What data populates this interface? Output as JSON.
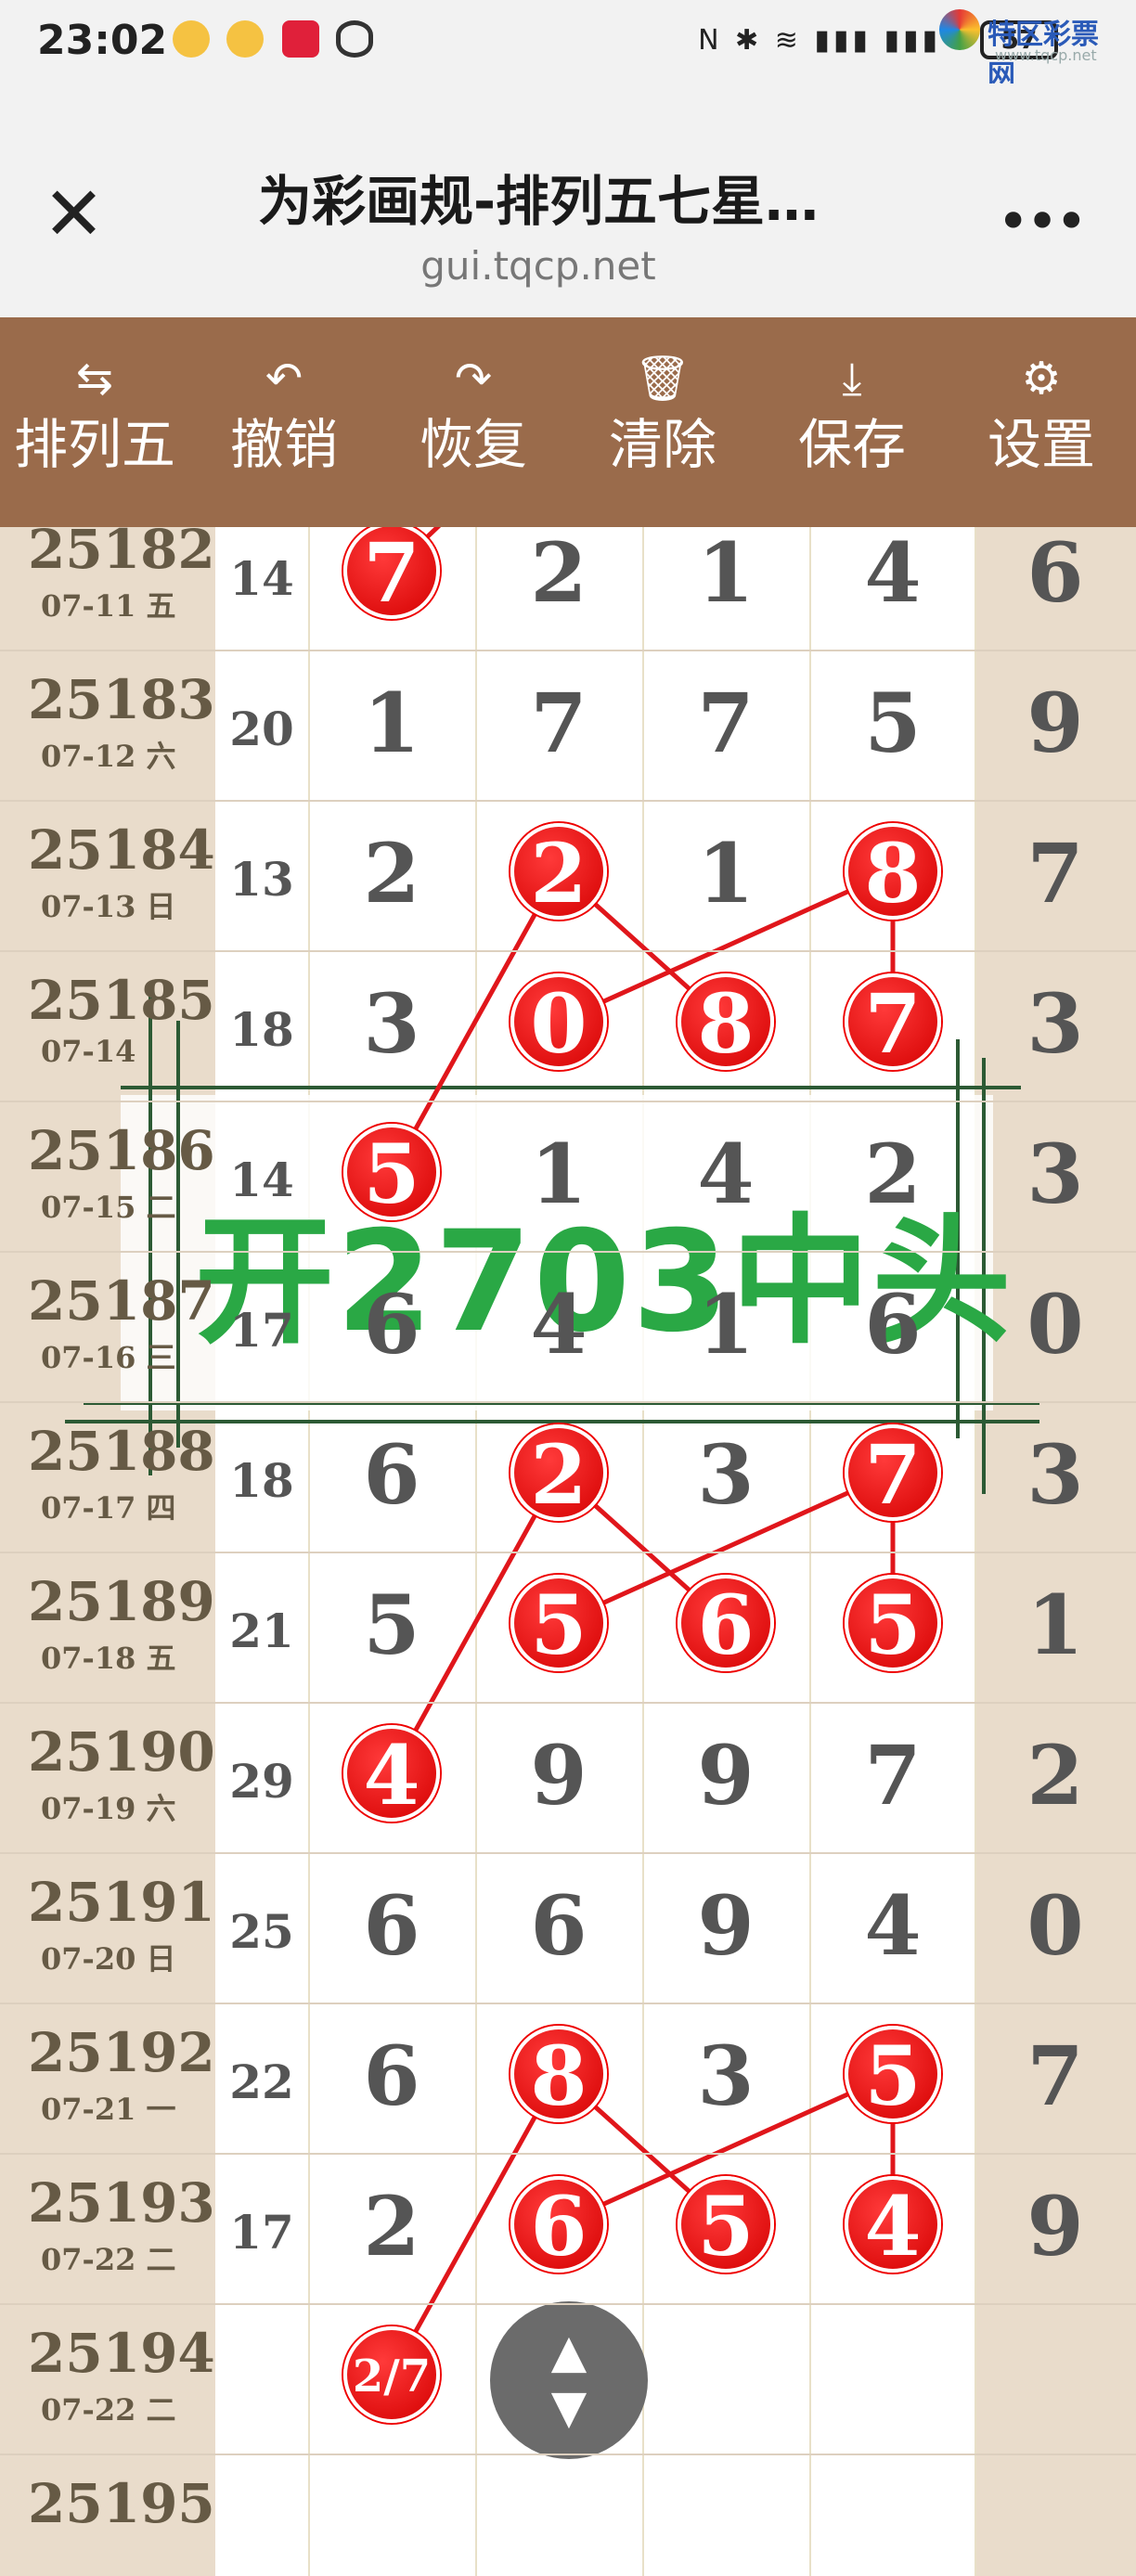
{
  "status": {
    "time": "23:02",
    "battery": "57",
    "brand": "特区彩票网",
    "brand_url": "www.tqcp.net"
  },
  "titlebar": {
    "title": "为彩画规-排列五七星…",
    "url": "gui.tqcp.net",
    "close": "✕",
    "more": "•••"
  },
  "toolbar": [
    {
      "icon": "⇆",
      "label": "排列五"
    },
    {
      "icon": "↶",
      "label": "撤销"
    },
    {
      "icon": "↷",
      "label": "恢复"
    },
    {
      "icon": "🗑",
      "label": "清除"
    },
    {
      "icon": "⤓",
      "label": "保存"
    },
    {
      "icon": "⚙",
      "label": "设置"
    }
  ],
  "overlay_text": "开2703中头",
  "rows": [
    {
      "issue": "25182",
      "date": "07-11 五",
      "sum": "14",
      "d": [
        "7",
        "2",
        "1",
        "4"
      ],
      "tail": "6",
      "hits": [
        0
      ]
    },
    {
      "issue": "25183",
      "date": "07-12 六",
      "sum": "20",
      "d": [
        "1",
        "7",
        "7",
        "5"
      ],
      "tail": "9",
      "hits": []
    },
    {
      "issue": "25184",
      "date": "07-13 日",
      "sum": "13",
      "d": [
        "2",
        "2",
        "1",
        "8"
      ],
      "tail": "7",
      "hits": [
        1,
        3
      ]
    },
    {
      "issue": "25185",
      "date": "07-14",
      "sum": "18",
      "d": [
        "3",
        "0",
        "8",
        "7"
      ],
      "tail": "3",
      "hits": [
        1,
        2,
        3
      ]
    },
    {
      "issue": "25186",
      "date": "07-15 二",
      "sum": "14",
      "d": [
        "5",
        "1",
        "4",
        "2"
      ],
      "tail": "3",
      "hits": [
        0
      ]
    },
    {
      "issue": "25187",
      "date": "07-16 三",
      "sum": "17",
      "d": [
        "6",
        "4",
        "1",
        "6"
      ],
      "tail": "0",
      "hits": []
    },
    {
      "issue": "25188",
      "date": "07-17 四",
      "sum": "18",
      "d": [
        "6",
        "2",
        "3",
        "7"
      ],
      "tail": "3",
      "hits": [
        1,
        3
      ]
    },
    {
      "issue": "25189",
      "date": "07-18 五",
      "sum": "21",
      "d": [
        "5",
        "5",
        "6",
        "5"
      ],
      "tail": "1",
      "hits": [
        1,
        2,
        3
      ]
    },
    {
      "issue": "25190",
      "date": "07-19 六",
      "sum": "29",
      "d": [
        "4",
        "9",
        "9",
        "7"
      ],
      "tail": "2",
      "hits": [
        0
      ]
    },
    {
      "issue": "25191",
      "date": "07-20 日",
      "sum": "25",
      "d": [
        "6",
        "6",
        "9",
        "4"
      ],
      "tail": "0",
      "hits": []
    },
    {
      "issue": "25192",
      "date": "07-21 一",
      "sum": "22",
      "d": [
        "6",
        "8",
        "3",
        "5"
      ],
      "tail": "7",
      "hits": [
        1,
        3
      ]
    },
    {
      "issue": "25193",
      "date": "07-22 二",
      "sum": "17",
      "d": [
        "2",
        "6",
        "5",
        "4"
      ],
      "tail": "9",
      "hits": [
        1,
        2,
        3
      ]
    },
    {
      "issue": "25194",
      "date": "07-22 二",
      "sum": "",
      "d": [
        "2/7",
        "",
        "",
        ""
      ],
      "tail": "",
      "hits": [
        0
      ]
    },
    {
      "issue": "25195",
      "date": "",
      "sum": "",
      "d": [
        "",
        "",
        "",
        ""
      ],
      "tail": "",
      "hits": []
    }
  ]
}
